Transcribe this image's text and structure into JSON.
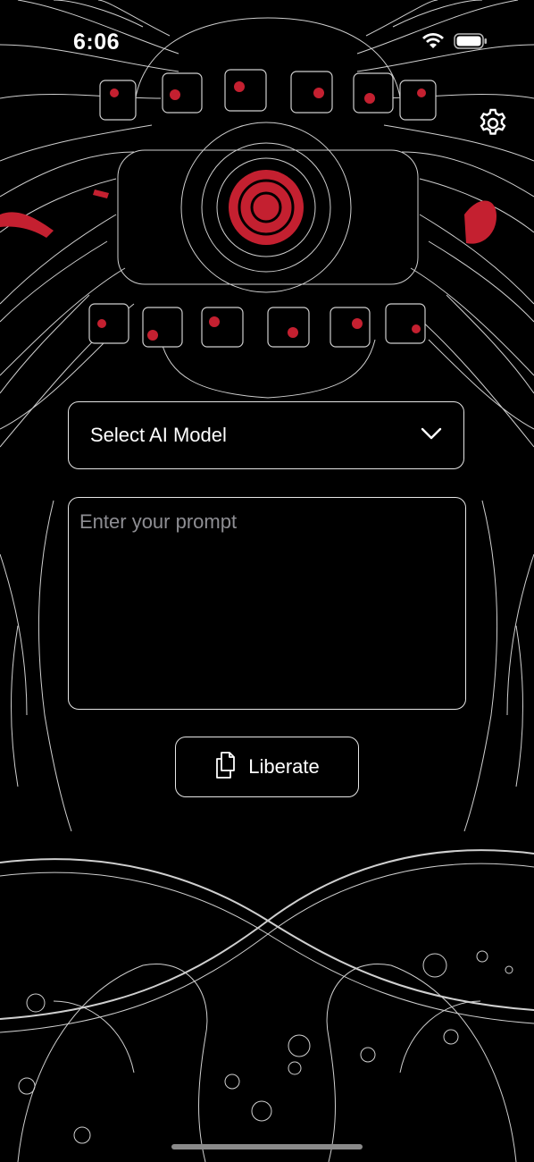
{
  "status_bar": {
    "time": "6:06",
    "icons": [
      "wifi-icon",
      "battery-icon"
    ]
  },
  "header": {
    "settings_icon": "gear-icon"
  },
  "model_select": {
    "label": "Select AI Model",
    "icon": "chevron-down-icon"
  },
  "prompt": {
    "placeholder": "Enter your prompt",
    "value": ""
  },
  "liberate_button": {
    "label": "Liberate",
    "icon": "copy-icon"
  },
  "colors": {
    "background": "#000000",
    "line_art": "#d8d8d8",
    "accent_red": "#d0202a",
    "border": "#e6e6e6",
    "placeholder": "#8e8e93"
  }
}
